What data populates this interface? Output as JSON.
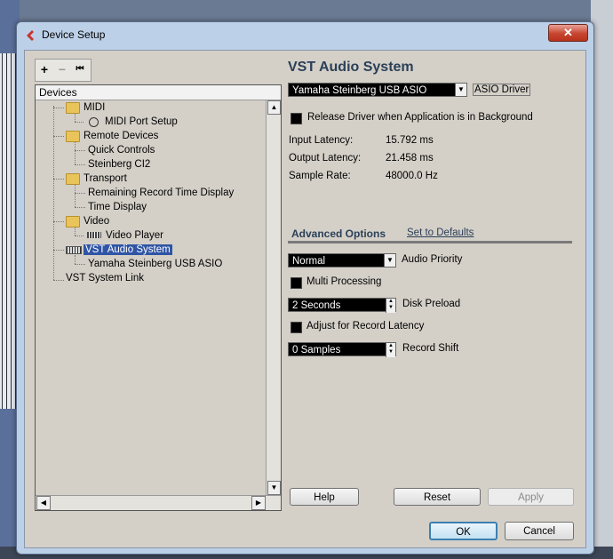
{
  "window": {
    "title": "Device Setup",
    "close_label": "✕"
  },
  "toolbar": {
    "add_label": "+",
    "remove_label": "−",
    "reset_label": "⏮"
  },
  "tree": {
    "header": "Devices",
    "items": [
      {
        "label": "MIDI"
      },
      {
        "label": "MIDI Port Setup"
      },
      {
        "label": "Remote Devices"
      },
      {
        "label": "Quick Controls"
      },
      {
        "label": "Steinberg CI2"
      },
      {
        "label": "Transport"
      },
      {
        "label": "Remaining Record Time Display"
      },
      {
        "label": "Time Display"
      },
      {
        "label": "Video"
      },
      {
        "label": "Video Player"
      },
      {
        "label": "VST Audio System"
      },
      {
        "label": "Yamaha Steinberg USB ASIO"
      },
      {
        "label": "VST System Link"
      }
    ]
  },
  "vst": {
    "heading": "VST Audio System",
    "driver": {
      "value": "Yamaha Steinberg USB ASIO",
      "label": "ASIO Driver"
    },
    "release_driver_label": "Release Driver when Application is in Background",
    "input_latency_label": "Input Latency:",
    "input_latency_value": "15.792 ms",
    "output_latency_label": "Output Latency:",
    "output_latency_value": "21.458 ms",
    "sample_rate_label": "Sample Rate:",
    "sample_rate_value": "48000.0 Hz"
  },
  "advanced": {
    "title": "Advanced Options",
    "defaults_link": "Set to Defaults",
    "audio_priority": {
      "value": "Normal",
      "label": "Audio Priority"
    },
    "multi_processing_label": "Multi Processing",
    "disk_preload": {
      "value": "2 Seconds",
      "label": "Disk Preload"
    },
    "adjust_latency_label": "Adjust for Record Latency",
    "record_shift": {
      "value": "0 Samples",
      "label": "Record Shift"
    }
  },
  "buttons": {
    "help": "Help",
    "reset": "Reset",
    "apply": "Apply",
    "ok": "OK",
    "cancel": "Cancel"
  },
  "colors": {
    "selection": "#2f55a4",
    "heading": "#2b3f58",
    "dialog_bg": "#d4d0c8"
  }
}
